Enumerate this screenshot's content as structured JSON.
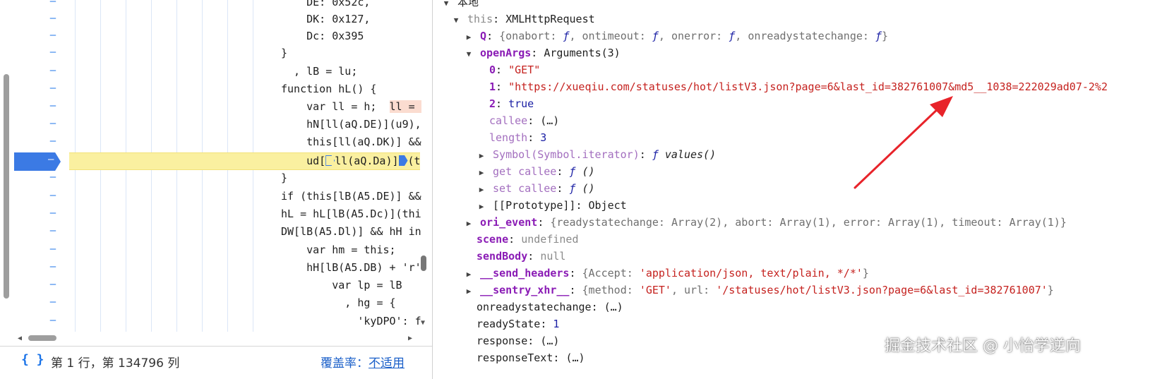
{
  "source": {
    "line_marker": "–",
    "paused_line_marker": "–",
    "lines": [
      {
        "code": "    DE: 0x52c,"
      },
      {
        "code": "    DK: 0x127,"
      },
      {
        "code": "    Dc: 0x395"
      },
      {
        "code": "}"
      },
      {
        "code": "  , lB = lu;"
      },
      {
        "code": "function hL() {"
      },
      {
        "code_a": "    var ll = h;  ",
        "code_b": "ll = "
      },
      {
        "code": "    hN[ll(aQ.DE)](u9),"
      },
      {
        "code": "    this[ll(aQ.DK)] &&"
      },
      {
        "code_a": "    ud[",
        "code_b": "ll(aQ.Da)]",
        "code_c": "(t"
      },
      {
        "code": "}"
      },
      {
        "code": "if (this[lB(A5.DE)] &&"
      },
      {
        "code": "hL = hL[lB(A5.Dc)](thi"
      },
      {
        "code": "DW[lB(A5.Dl)] && hH in"
      },
      {
        "code": "    var hm = this;"
      },
      {
        "code": "    hH[lB(A5.DB) + 'r'"
      },
      {
        "code": "        var lp = lB"
      },
      {
        "code": "          , hg = {"
      },
      {
        "code": "            'kyDPO': f"
      }
    ]
  },
  "status": {
    "braces": "{ }",
    "position": "第 1 行，第 134796 列",
    "coverage_label": "覆盖率：",
    "coverage_value": "不适用"
  },
  "scope": {
    "header": "本地",
    "this_key": "this",
    "this_value": "XMLHttpRequest",
    "Q": {
      "key": "Q",
      "preview_a": "{onabort: ",
      "f1": "ƒ",
      "preview_b": ", ontimeout: ",
      "f2": "ƒ",
      "preview_c": ", onerror: ",
      "f3": "ƒ",
      "preview_d": ", onreadystatechange: ",
      "f4": "ƒ",
      "preview_e": "}"
    },
    "openArgs": {
      "key": "openArgs",
      "value": "Arguments(3)"
    },
    "arg0": {
      "key": "0",
      "value": "\"GET\""
    },
    "arg1": {
      "key": "1",
      "value": "\"https://xueqiu.com/statuses/hot/listV3.json?page=6&last_id=382761007&md5__1038=222029ad07-2%2"
    },
    "arg2": {
      "key": "2",
      "value": "true"
    },
    "callee": {
      "key": "callee",
      "value": "(…)"
    },
    "length": {
      "key": "length",
      "value": "3"
    },
    "symbol_iter": {
      "key": "Symbol(Symbol.iterator)",
      "f": "ƒ",
      "value": " values()"
    },
    "get_callee": {
      "key": "get callee",
      "f": "ƒ",
      "value": " ()"
    },
    "set_callee": {
      "key": "set callee",
      "f": "ƒ",
      "value": " ()"
    },
    "prototype": {
      "key": "[[Prototype]]",
      "value": "Object"
    },
    "ori_event": {
      "key": "ori_event",
      "value": "{readystatechange: Array(2), abort: Array(1), error: Array(1), timeout: Array(1)}"
    },
    "scene": {
      "key": "scene",
      "value": "undefined"
    },
    "sendBody": {
      "key": "sendBody",
      "value": "null"
    },
    "send_headers": {
      "key": "__send_headers",
      "value_a": "{Accept: ",
      "value_b": "'application/json, text/plain, */*'",
      "value_c": "}"
    },
    "sentry_xhr": {
      "key": "__sentry_xhr__",
      "value_a": "{method: ",
      "value_b": "'GET'",
      "value_c": ", url: ",
      "value_d": "'/statuses/hot/listV3.json?page=6&last_id=382761007'",
      "value_e": "}"
    },
    "onreadystatechange": {
      "key": "onreadystatechange",
      "value": "(…)"
    },
    "readyState": {
      "key": "readyState",
      "value": "1"
    },
    "response": {
      "key": "response",
      "value": "(…)"
    },
    "responseText": {
      "key": "responseText",
      "value": "(…)"
    }
  },
  "watermark": "掘金技术社区 @ 小怡学逆向",
  "colors": {
    "accent": "#1a73e8",
    "paused_line": "#faf0a0",
    "arrow": "#e8232a"
  }
}
